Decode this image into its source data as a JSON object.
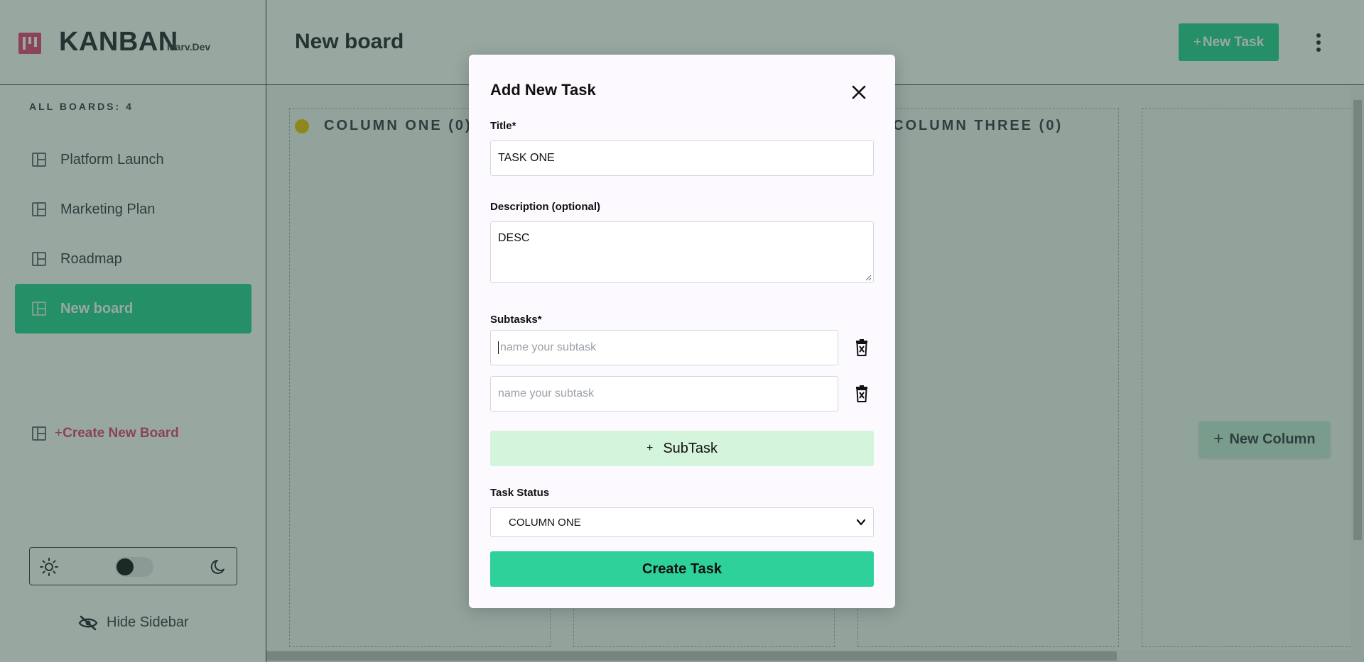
{
  "app": {
    "logo_title": "KANBAN",
    "logo_sub": "Marv.Dev",
    "boards_count": "ALL BOARDS: 4",
    "accent": "#2ed19a",
    "brand": "#e5487d"
  },
  "sidebar": {
    "items": [
      {
        "label": "Platform Launch",
        "icon": "board-icon",
        "active": false
      },
      {
        "label": "Marketing Plan",
        "icon": "board-icon",
        "active": false
      },
      {
        "label": "Roadmap",
        "icon": "board-icon",
        "active": false
      },
      {
        "label": "New board",
        "icon": "board-icon",
        "active": true
      }
    ],
    "create_board_plus": "+",
    "create_board_label": "Create New Board",
    "hide_sidebar": "Hide Sidebar",
    "theme": {
      "mode": "light",
      "icons": [
        "sun-icon",
        "moon-icon"
      ]
    }
  },
  "header": {
    "board_title": "New board",
    "new_task_plus": "+",
    "new_task_label": "New Task"
  },
  "board": {
    "columns": [
      {
        "title": "COLUMN ONE (0)",
        "dot_color": "#f1c40f"
      },
      {
        "title": "COLUMN THREE (0)"
      }
    ],
    "new_column_plus": "+",
    "new_column_label": "New Column"
  },
  "modal": {
    "title": "Add New Task",
    "title_label": "Title*",
    "title_value": "TASK ONE",
    "description_label": "Description (optional)",
    "description_value": "DESC",
    "subtasks_label": "Subtasks*",
    "subtasks": [
      {
        "value": "",
        "placeholder": "name your subtask"
      },
      {
        "value": "",
        "placeholder": "name your subtask"
      }
    ],
    "add_subtask_plus": "+",
    "add_subtask_label": "SubTask",
    "status_label": "Task Status",
    "status_value": "COLUMN ONE",
    "create_label": "Create Task"
  }
}
